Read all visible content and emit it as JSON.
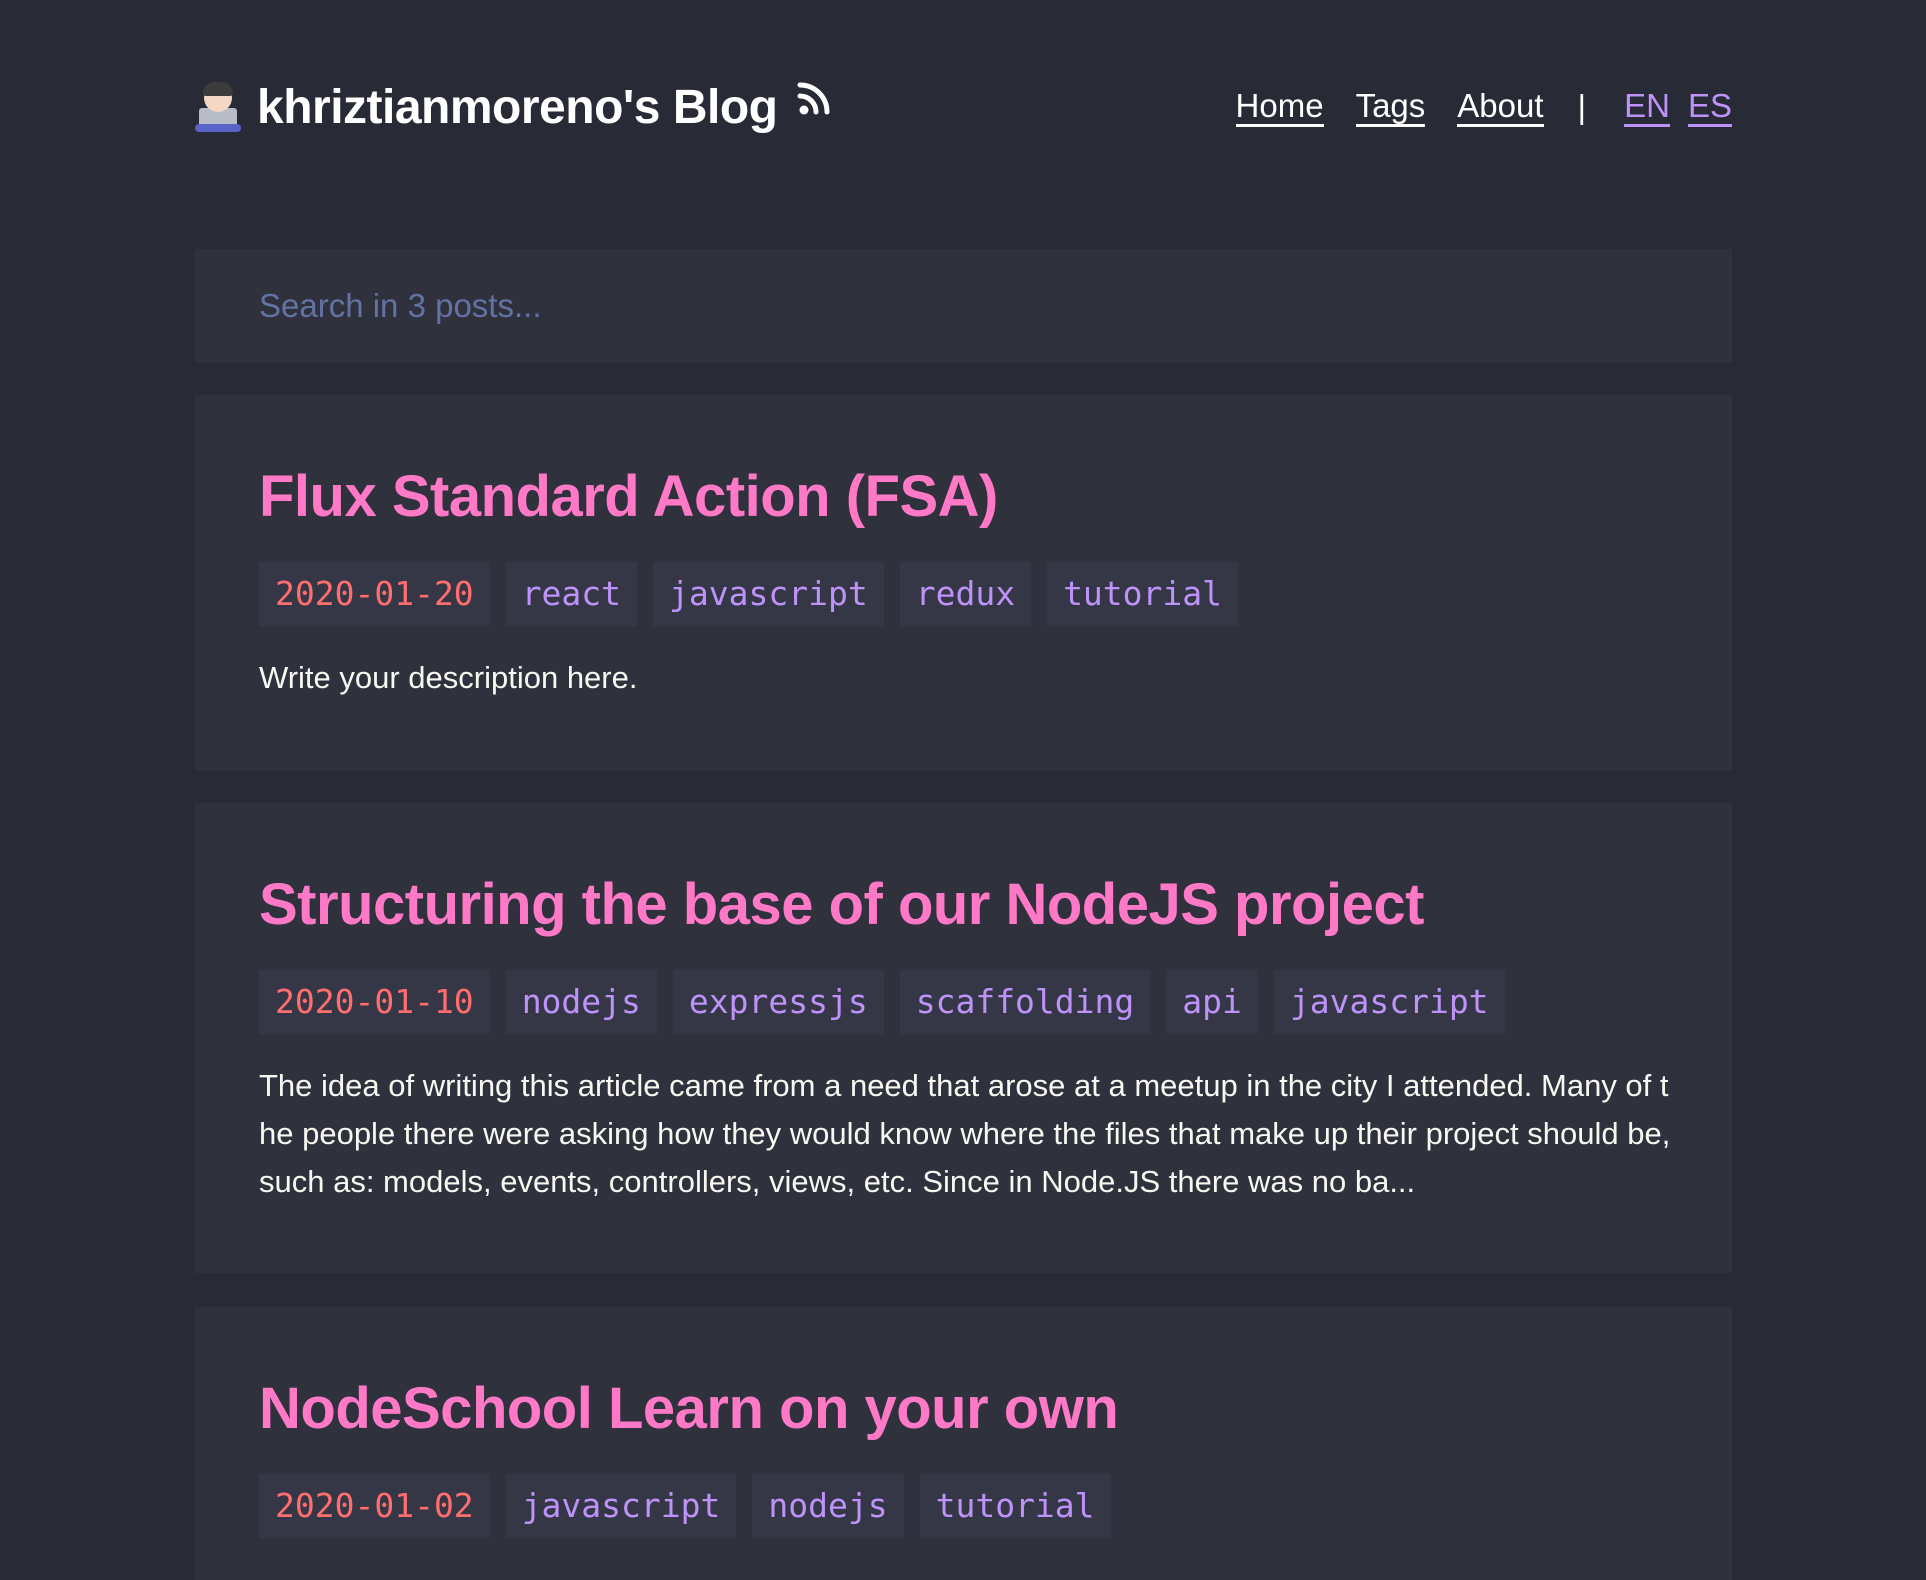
{
  "header": {
    "site_title": "khriztianmoreno's Blog",
    "avatar_icon": "technologist-emoji-icon",
    "rss_icon": "rss-icon",
    "nav": {
      "home": "Home",
      "tags": "Tags",
      "about": "About",
      "separator": "|",
      "lang_en": "EN",
      "lang_es": "ES"
    }
  },
  "search": {
    "placeholder": "Search in 3 posts..."
  },
  "posts": [
    {
      "title": "Flux Standard Action (FSA)",
      "date": "2020-01-20",
      "tags": [
        "react",
        "javascript",
        "redux",
        "tutorial"
      ],
      "description": "Write your description here."
    },
    {
      "title": "Structuring the base of our NodeJS project",
      "date": "2020-01-10",
      "tags": [
        "nodejs",
        "expressjs",
        "scaffolding",
        "api",
        "javascript"
      ],
      "description": "The idea of writing this article came from a need that arose at a meetup in the city I attended. Many of the people there were asking how they would know where the files that make up their project should be, such as: models, events, controllers, views, etc. Since in Node.JS there was no ba..."
    },
    {
      "title": "NodeSchool Learn on your own",
      "date": "2020-01-02",
      "tags": [
        "javascript",
        "nodejs",
        "tutorial"
      ],
      "description": ""
    }
  ],
  "colors": {
    "background": "#282a36",
    "card": "#2f313d",
    "title_pink": "#ff79c6",
    "tag_purple": "#bd93f9",
    "date_red": "#ff6e6e"
  }
}
